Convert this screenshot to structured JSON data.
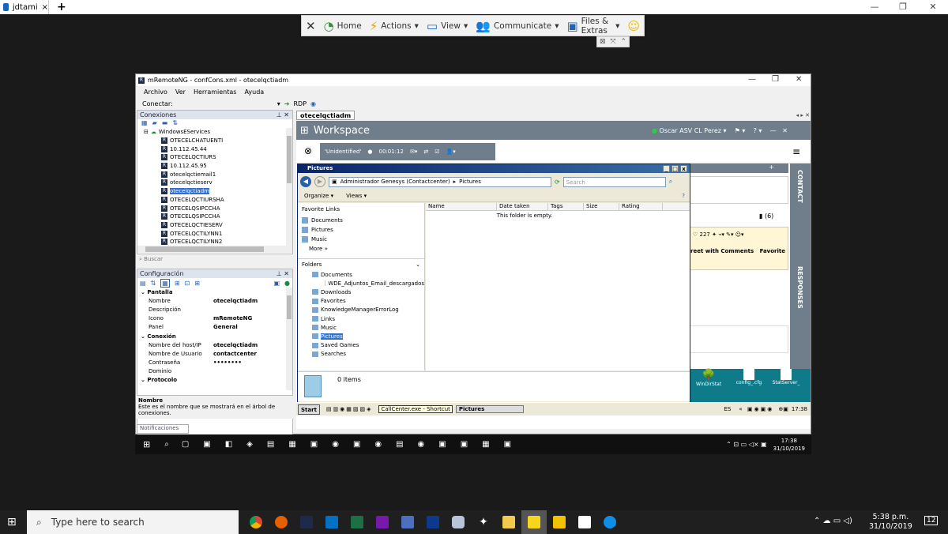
{
  "host_tab": {
    "label": "jdtami",
    "close": "×",
    "new": "+"
  },
  "host_window": {
    "minimize": "—",
    "maximize": "❐",
    "close": "✕"
  },
  "teamviewer_toolbar": {
    "items": [
      {
        "label": "",
        "icon": "close-icon"
      },
      {
        "label": "Home",
        "icon": "home-icon"
      },
      {
        "label": "Actions",
        "icon": "lightning-icon"
      },
      {
        "label": "View",
        "icon": "monitor-icon"
      },
      {
        "label": "Communicate",
        "icon": "users-icon"
      },
      {
        "label": "Files & Extras",
        "icon": "folder-icon"
      },
      {
        "label": "",
        "icon": "smiley-icon"
      }
    ]
  },
  "mremote": {
    "title": "mRemoteNG - confCons.xml - otecelqctiadm",
    "menu": [
      "Archivo",
      "Ver",
      "Herramientas",
      "Ayuda"
    ],
    "conectar_label": "Conectar:",
    "rdp_label": "RDP",
    "conexiones_title": "Conexiones",
    "tree_root": "WindowsEServices",
    "tree_items": [
      "OTECELCHATUENTI",
      "10.112.45.44",
      "OTECELQCTIURS",
      "10.112.45.95",
      "otecelqctiemail1",
      "otecelqctieserv",
      "otecelqctiadm",
      "OTECELQCTIURSHA",
      "OTECELQSIPCCHA",
      "OTECELQSIPCCHA",
      "OTECELQCTIESERV",
      "OTECELQCTILYNN1",
      "OTECELQCTILYNN2"
    ],
    "selected_item": "otecelqctiadm",
    "search_placeholder": "Buscar",
    "config_title": "Configuración",
    "properties": [
      {
        "type": "cat",
        "key": "Pantalla",
        "value": ""
      },
      {
        "type": "prop",
        "key": "Nombre",
        "value": "otecelqctiadm"
      },
      {
        "type": "prop",
        "key": "Descripción",
        "value": ""
      },
      {
        "type": "prop",
        "key": "Icono",
        "value": "mRemoteNG"
      },
      {
        "type": "prop",
        "key": "Panel",
        "value": "General"
      },
      {
        "type": "cat",
        "key": "Conexión",
        "value": ""
      },
      {
        "type": "prop",
        "key": "Nombre del host/IP",
        "value": "otecelqctiadm"
      },
      {
        "type": "prop",
        "key": "Nombre de Usuario",
        "value": "contactcenter"
      },
      {
        "type": "prop",
        "key": "Contraseña",
        "value": "••••••••"
      },
      {
        "type": "prop",
        "key": "Dominio",
        "value": ""
      },
      {
        "type": "cat",
        "key": "Protocolo",
        "value": ""
      }
    ],
    "desc_title": "Nombre",
    "desc_text": "Este es el nombre que se mostrará en el árbol de conexiones.",
    "notif_label": "Notificaciones",
    "session_tab": "otecelqctiadm"
  },
  "workspace": {
    "title": "Workspace",
    "user": "Oscar ASV CL Perez",
    "status": "'Unidentified'",
    "timer": "00:01:12",
    "count": "(6)",
    "retweets": "227",
    "reply_label": "reet with Comments",
    "favorite_label": "Favorite",
    "contact_label": "CONTACT",
    "responses_label": "RESPONSES",
    "desktop_icons": [
      "WinDirStat",
      "config_.cfg",
      "StatServer_"
    ]
  },
  "explorer": {
    "title": "Pictures",
    "breadcrumb": [
      "Administrador Genesys (Contactcenter)",
      "Pictures"
    ],
    "search_placeholder": "Search",
    "organize": "Organize",
    "views": "Views",
    "favorite_links_title": "Favorite Links",
    "favorite_links": [
      "Documents",
      "Pictures",
      "Music"
    ],
    "more": "More",
    "folders_title": "Folders",
    "folders": [
      "Documents",
      "WDE_Adjuntos_Email_descargados",
      "Downloads",
      "Favorites",
      "KnowledgeManagerErrorLog",
      "Links",
      "Music",
      "Pictures",
      "Saved Games",
      "Searches"
    ],
    "selected_folder": "Pictures",
    "columns": [
      "Name",
      "Date taken",
      "Tags",
      "Size",
      "Rating"
    ],
    "empty_text": "This folder is empty.",
    "items_count": "0 items"
  },
  "xp_taskbar": {
    "start": "Start",
    "tooltip": "CallCenter.exe - Shortcut",
    "active_window": "Pictures",
    "lang": "ES",
    "time": "17:38"
  },
  "remote_win10_taskbar": {
    "time": "17:38",
    "date": "31/10/2019"
  },
  "host_taskbar": {
    "search_placeholder": "Type here to search",
    "time": "5:38 p.m.",
    "date": "31/10/2019",
    "notifications": "12"
  },
  "colors": {
    "workspace_header": "#6f7e8a",
    "xp_title": "#0a246a",
    "selection": "#2f6fd0"
  }
}
